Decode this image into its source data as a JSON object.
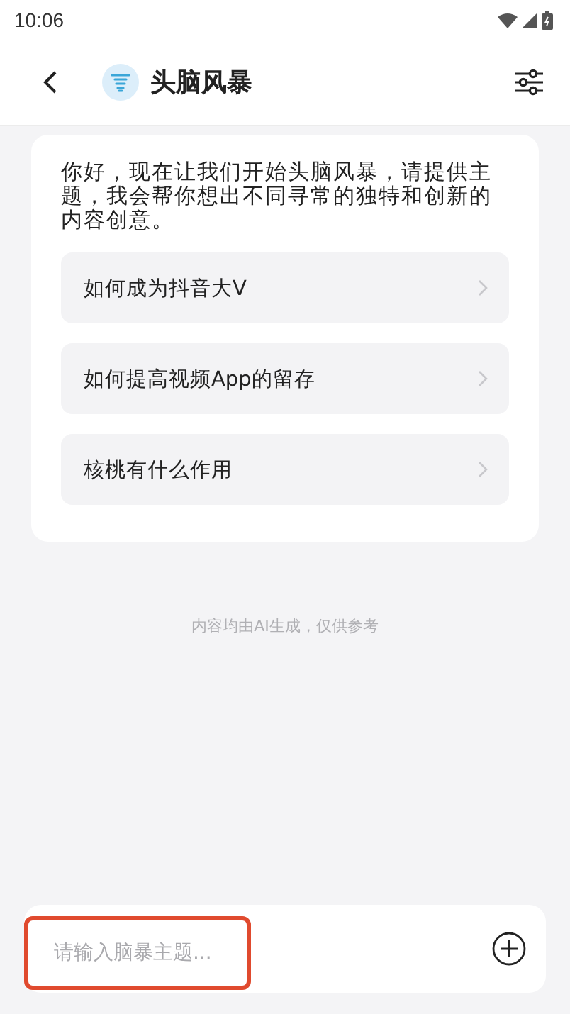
{
  "status_bar": {
    "time": "10:06"
  },
  "header": {
    "title": "头脑风暴"
  },
  "greeting": "你好，现在让我们开始头脑风暴，请提供主题，我会帮你想出不同寻常的独特和创新的内容创意。",
  "suggestions": [
    "如何成为抖音大V",
    "如何提高视频App的留存",
    "核桃有什么作用"
  ],
  "disclaimer": "内容均由AI生成，仅供参考",
  "input": {
    "placeholder": "请输入脑暴主题..."
  }
}
